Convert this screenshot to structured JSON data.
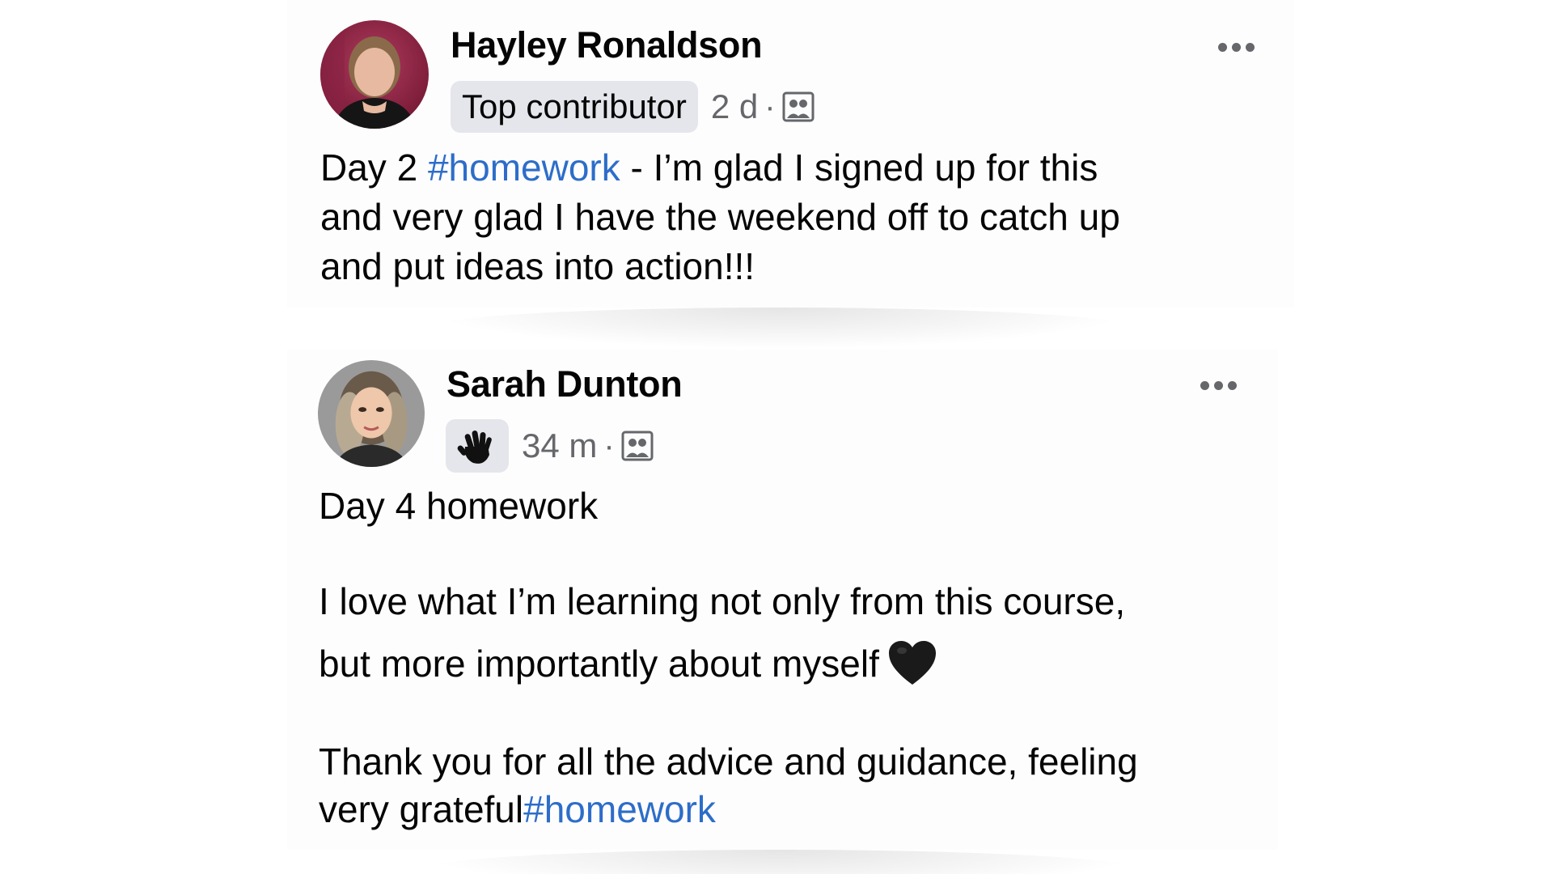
{
  "posts": [
    {
      "author": "Hayley Ronaldson",
      "badge": "Top contributor",
      "time": "2 d",
      "separator": "·",
      "privacy_icon": "group-icon",
      "avatar_icon": "avatar-hayley",
      "lines": [
        {
          "before": "Day 2 ",
          "hashtag": "#homework",
          "after": " - I’m glad I signed up for this"
        },
        {
          "text": "and very glad I have the weekend off to catch up"
        },
        {
          "text": "and put ideas into action!!!"
        }
      ]
    },
    {
      "author": "Sarah Dunton",
      "badge_icon": "waving-hand-icon",
      "time": "34 m",
      "separator": "·",
      "privacy_icon": "group-icon",
      "avatar_icon": "avatar-sarah",
      "lines": [
        {
          "text": "Day 4 homework"
        },
        {
          "text": "I love what I’m learning not only from this course,"
        },
        {
          "text": "but more importantly about myself",
          "emoji": "black-heart-icon"
        },
        {
          "text": "Thank you for all the advice and guidance, feeling"
        },
        {
          "before": "very grateful",
          "hashtag": "#homework"
        }
      ]
    }
  ],
  "colors": {
    "hashtag": "#2d6dc9",
    "meta_text": "#65676b",
    "badge_bg": "#e4e6eb",
    "text": "#050505"
  },
  "icons": {
    "more": "more-options-icon"
  }
}
